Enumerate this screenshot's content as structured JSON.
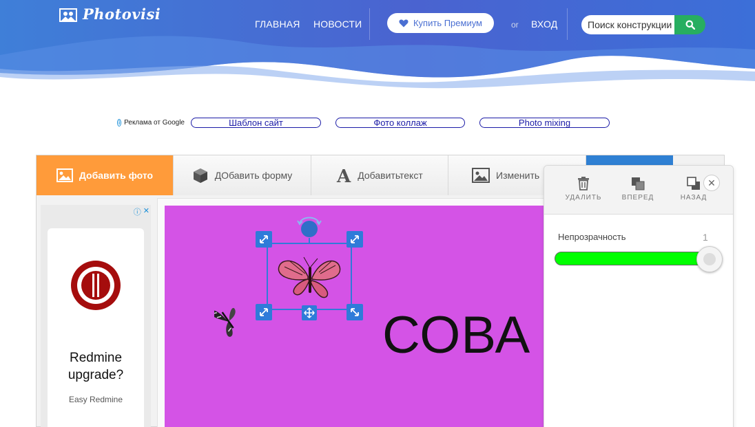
{
  "header": {
    "logo_text": "Photovisi",
    "nav": {
      "home": "ГЛАВНАЯ",
      "news": "НОВОСТИ"
    },
    "premium_label": "Купить Премиум",
    "or_label": "or",
    "login_label": "ВХОД",
    "search_placeholder": "Поиск конструкции"
  },
  "ads_row": {
    "label": "Реклама от Google",
    "links": [
      "Шаблон сайт",
      "Фото коллаж",
      "Photo mixing"
    ]
  },
  "toolbar": {
    "tabs": [
      "Добавить фото",
      "ДОбавить форму",
      "Добавитьтекст",
      "Изменить"
    ]
  },
  "side_ad": {
    "title": "Redmine upgrade?",
    "subtitle": "Easy Redmine"
  },
  "canvas": {
    "background_color": "#d453e6",
    "text": "СОВА"
  },
  "panel": {
    "delete_label": "УДАЛИТЬ",
    "forward_label": "ВПЕРЕД",
    "back_label": "НАЗАД",
    "opacity_label": "Непрозрачность",
    "opacity_value": "1"
  },
  "colors": {
    "active_tab": "#ff9b3a",
    "search_button": "#27ae60",
    "slider_fill": "#00ff00",
    "handle": "#2f7bd9"
  }
}
